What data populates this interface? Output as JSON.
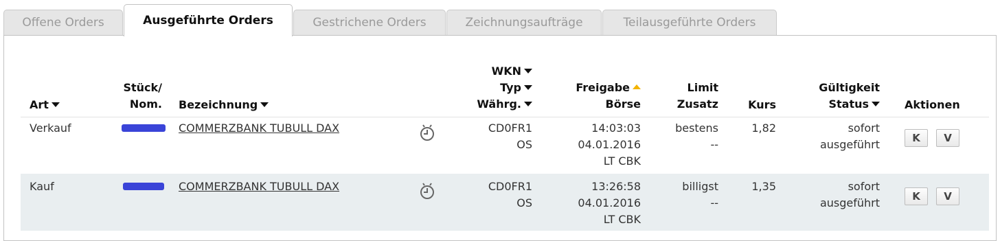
{
  "tabs": [
    {
      "label": "Offene Orders",
      "active": false
    },
    {
      "label": "Ausgeführte Orders",
      "active": true
    },
    {
      "label": "Gestrichene Orders",
      "active": false
    },
    {
      "label": "Zeichnungsaufträge",
      "active": false
    },
    {
      "label": "Teilausgeführte Orders",
      "active": false
    }
  ],
  "table": {
    "headers": {
      "art": "Art",
      "stueck_line1": "Stück/",
      "stueck_line2": "Nom.",
      "bezeichnung": "Bezeichnung",
      "wkn": "WKN",
      "typ": "Typ",
      "waehrg": "Währg.",
      "freigabe": "Freigabe",
      "boerse": "Börse",
      "limit": "Limit",
      "zusatz": "Zusatz",
      "kurs": "Kurs",
      "gueltigkeit": "Gültigkeit",
      "status": "Status",
      "aktionen": "Aktionen"
    },
    "rows": [
      {
        "art": "Verkauf",
        "bezeichnung": "COMMERZBANK TUBULL DAX",
        "wkn": "CD0FR1",
        "typ": "OS",
        "zeit": "14:03:03",
        "datum": "04.01.2016",
        "boerse": "LT CBK",
        "limit": "bestens",
        "zusatz": "--",
        "kurs": "1,82",
        "gueltigkeit": "sofort",
        "status": "ausgeführt",
        "btn_k": "K",
        "btn_v": "V"
      },
      {
        "art": "Kauf",
        "bezeichnung": "COMMERZBANK TUBULL DAX",
        "wkn": "CD0FR1",
        "typ": "OS",
        "zeit": "13:26:58",
        "datum": "04.01.2016",
        "boerse": "LT CBK",
        "limit": "billigst",
        "zusatz": "--",
        "kurs": "1,35",
        "gueltigkeit": "sofort",
        "status": "ausgeführt",
        "btn_k": "K",
        "btn_v": "V"
      }
    ]
  },
  "colors": {
    "redaction": "#3a44d8",
    "sort_active": "#f3b400",
    "row_alt_bg": "#e9eef0"
  }
}
